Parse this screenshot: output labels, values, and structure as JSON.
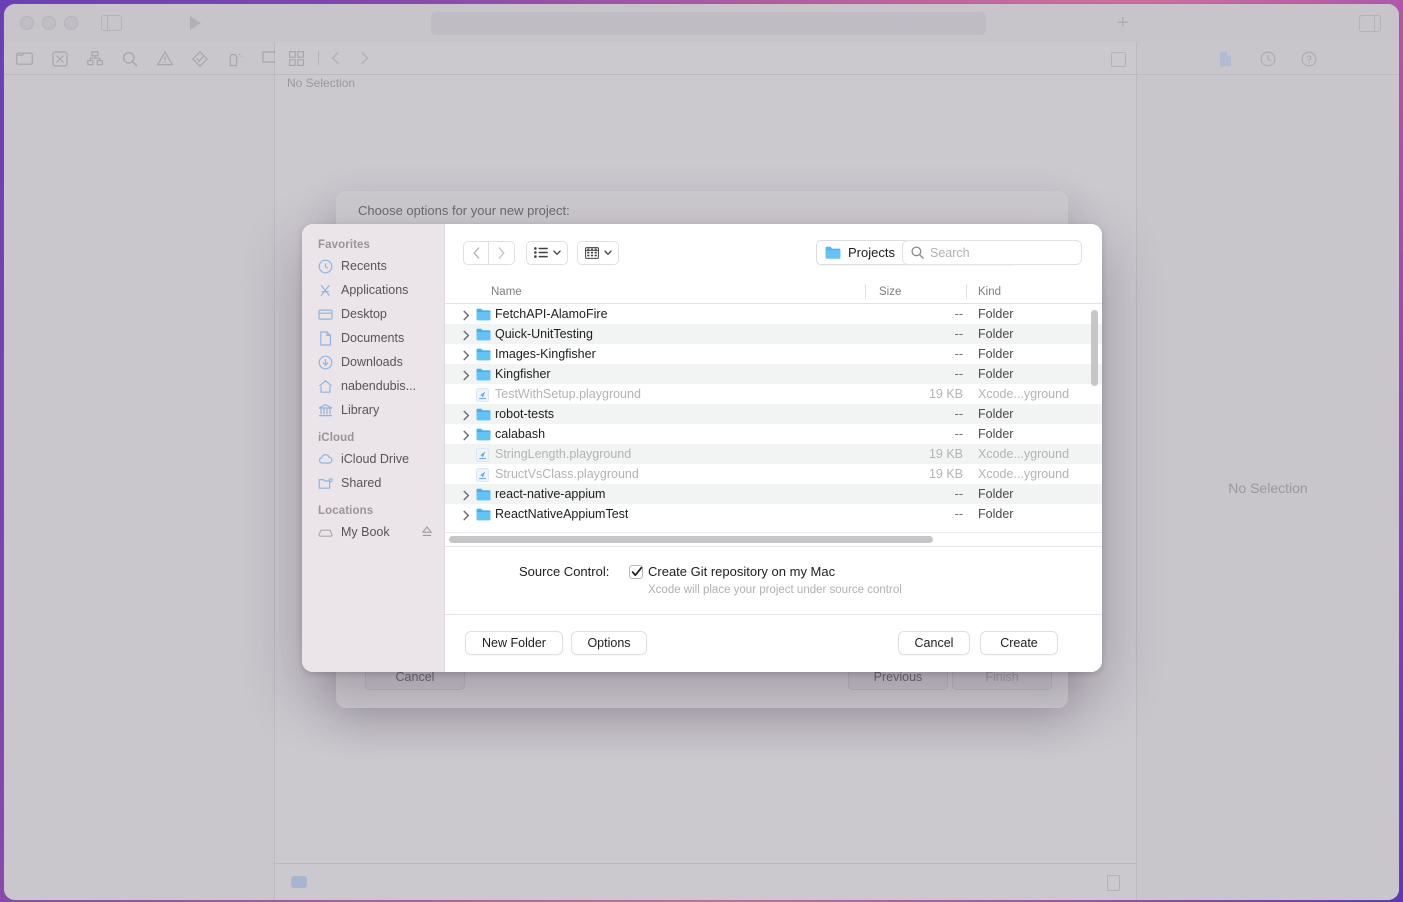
{
  "xcode": {
    "editor_no_selection": "No Selection",
    "inspector_no_selection": "No Selection",
    "nav_icons": [
      "folder-icon",
      "issue-icon",
      "hierarchy-icon",
      "search-icon",
      "warning-icon",
      "test-icon",
      "debug-icon",
      "breakpoint-icon",
      "report-icon"
    ],
    "inspector_icons": [
      "file-inspector-icon",
      "history-inspector-icon",
      "quick-help-icon"
    ],
    "titlebar_icons": [
      "close-button",
      "minimize-button",
      "zoom-button",
      "sidebar-toggle-icon",
      "run-icon",
      "add-icon",
      "inspector-toggle-icon"
    ]
  },
  "wizard": {
    "header": "Choose options for your new project:",
    "cancel": "Cancel",
    "previous": "Previous",
    "finish": "Finish"
  },
  "sheet": {
    "sidebar": {
      "groups": [
        {
          "title": "Favorites",
          "items": [
            {
              "label": "Recents",
              "icon": "clock-icon"
            },
            {
              "label": "Applications",
              "icon": "applications-icon"
            },
            {
              "label": "Desktop",
              "icon": "desktop-icon"
            },
            {
              "label": "Documents",
              "icon": "document-icon"
            },
            {
              "label": "Downloads",
              "icon": "download-icon"
            },
            {
              "label": "nabendubis...",
              "icon": "home-icon"
            },
            {
              "label": "Library",
              "icon": "library-icon"
            }
          ]
        },
        {
          "title": "iCloud",
          "items": [
            {
              "label": "iCloud Drive",
              "icon": "cloud-icon"
            },
            {
              "label": "Shared",
              "icon": "shared-folder-icon"
            }
          ]
        },
        {
          "title": "Locations",
          "items": [
            {
              "label": "My Book",
              "icon": "external-drive-icon",
              "eject": true
            }
          ]
        }
      ]
    },
    "toolbar": {
      "back_icon": "chevron-left-icon",
      "forward_icon": "chevron-right-icon",
      "list_view_icon": "list-view-icon",
      "icon_view_icon": "icon-view-icon",
      "path_label": "Projects",
      "path_icon": "folder-icon",
      "search_placeholder": "Search",
      "search_value": ""
    },
    "columns": [
      "Name",
      "Size",
      "Kind"
    ],
    "files": [
      {
        "name": "FetchAPI-AlamoFire",
        "size": "--",
        "kind": "Folder",
        "type": "folder",
        "dim": false
      },
      {
        "name": "Quick-UnitTesting",
        "size": "--",
        "kind": "Folder",
        "type": "folder",
        "dim": false
      },
      {
        "name": "Images-Kingfisher",
        "size": "--",
        "kind": "Folder",
        "type": "folder",
        "dim": false
      },
      {
        "name": "Kingfisher",
        "size": "--",
        "kind": "Folder",
        "type": "folder",
        "dim": false
      },
      {
        "name": "TestWithSetup.playground",
        "size": "19 KB",
        "kind": "Xcode...yground",
        "type": "playground",
        "dim": true
      },
      {
        "name": "robot-tests",
        "size": "--",
        "kind": "Folder",
        "type": "folder",
        "dim": false
      },
      {
        "name": "calabash",
        "size": "--",
        "kind": "Folder",
        "type": "folder",
        "dim": false
      },
      {
        "name": "StringLength.playground",
        "size": "19 KB",
        "kind": "Xcode...yground",
        "type": "playground",
        "dim": true
      },
      {
        "name": "StructVsClass.playground",
        "size": "19 KB",
        "kind": "Xcode...yground",
        "type": "playground",
        "dim": true
      },
      {
        "name": "react-native-appium",
        "size": "--",
        "kind": "Folder",
        "type": "folder",
        "dim": false
      },
      {
        "name": "ReactNativeAppiumTest",
        "size": "--",
        "kind": "Folder",
        "type": "folder",
        "dim": false
      }
    ],
    "accessory": {
      "source_control_label": "Source Control:",
      "checkbox_checked": true,
      "checkbox_label": "Create Git repository on my Mac",
      "sublabel": "Xcode will place your project under source control"
    },
    "footer": {
      "new_folder": "New Folder",
      "options": "Options",
      "cancel": "Cancel",
      "create": "Create"
    }
  },
  "colors": {
    "folder_blue": "#56b7f5",
    "sidebar_icon_blue": "#8fb4e0",
    "sidebar_bg": "#ebe5e9",
    "row_alt": "#f2f3f3"
  }
}
